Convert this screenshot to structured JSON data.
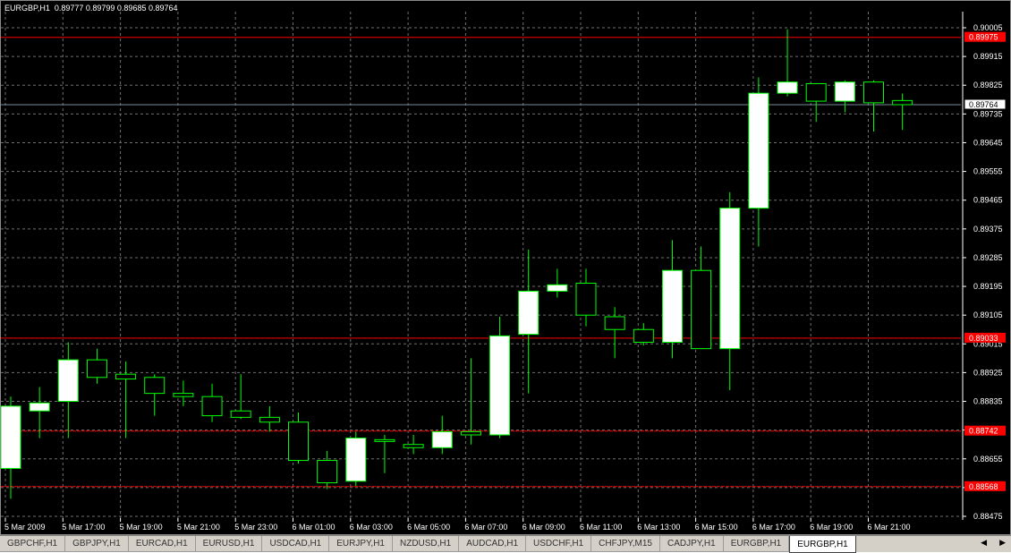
{
  "header": {
    "info": "EURGBP,H1  0.89777 0.89799 0.89685 0.89764"
  },
  "price_axis": {
    "ticks": [
      "0.90005",
      "0.89915",
      "0.89825",
      "0.89735",
      "0.89645",
      "0.89555",
      "0.89465",
      "0.89375",
      "0.89285",
      "0.89195",
      "0.89105",
      "0.89015",
      "0.88925",
      "0.88835",
      "0.88745",
      "0.88655",
      "0.88565",
      "0.88475"
    ]
  },
  "time_axis": {
    "labels": [
      "5 Mar 2009",
      "5 Mar 17:00",
      "5 Mar 19:00",
      "5 Mar 21:00",
      "5 Mar 23:00",
      "6 Mar 01:00",
      "6 Mar 03:00",
      "6 Mar 05:00",
      "6 Mar 07:00",
      "6 Mar 09:00",
      "6 Mar 11:00",
      "6 Mar 13:00",
      "6 Mar 15:00",
      "6 Mar 17:00",
      "6 Mar 19:00",
      "6 Mar 21:00"
    ]
  },
  "levels": [
    {
      "price": 0.89975,
      "label": "0.89975",
      "color": "#ff0000",
      "style": "solid"
    },
    {
      "price": 0.89033,
      "label": "0.89033",
      "color": "#ff0000",
      "style": "solid"
    },
    {
      "price": 0.88742,
      "label": "0.88742",
      "color": "#ff0000",
      "style": "dashed"
    },
    {
      "price": 0.88568,
      "label": "0.88568",
      "color": "#ff0000",
      "style": "dashed"
    }
  ],
  "bid_line": {
    "price": 0.89764,
    "label": "0.89764",
    "color": "#778899"
  },
  "candles": [
    {
      "o": 0.88625,
      "h": 0.8885,
      "l": 0.8853,
      "c": 0.8882
    },
    {
      "o": 0.88805,
      "h": 0.8888,
      "l": 0.8872,
      "c": 0.8883
    },
    {
      "o": 0.88835,
      "h": 0.8902,
      "l": 0.8872,
      "c": 0.88965
    },
    {
      "o": 0.88965,
      "h": 0.89,
      "l": 0.8889,
      "c": 0.8891
    },
    {
      "o": 0.8892,
      "h": 0.8896,
      "l": 0.8872,
      "c": 0.88905
    },
    {
      "o": 0.8891,
      "h": 0.8892,
      "l": 0.8879,
      "c": 0.8886
    },
    {
      "o": 0.8886,
      "h": 0.889,
      "l": 0.8882,
      "c": 0.8885
    },
    {
      "o": 0.8885,
      "h": 0.8889,
      "l": 0.8877,
      "c": 0.8879
    },
    {
      "o": 0.88805,
      "h": 0.8892,
      "l": 0.8878,
      "c": 0.88785
    },
    {
      "o": 0.88785,
      "h": 0.8882,
      "l": 0.8874,
      "c": 0.8877
    },
    {
      "o": 0.8877,
      "h": 0.888,
      "l": 0.8864,
      "c": 0.8865
    },
    {
      "o": 0.8865,
      "h": 0.8868,
      "l": 0.8856,
      "c": 0.8858
    },
    {
      "o": 0.88585,
      "h": 0.8874,
      "l": 0.8857,
      "c": 0.8872
    },
    {
      "o": 0.88715,
      "h": 0.8873,
      "l": 0.8861,
      "c": 0.8871
    },
    {
      "o": 0.887,
      "h": 0.8873,
      "l": 0.8867,
      "c": 0.8869
    },
    {
      "o": 0.8869,
      "h": 0.8879,
      "l": 0.8867,
      "c": 0.8874
    },
    {
      "o": 0.8874,
      "h": 0.8897,
      "l": 0.887,
      "c": 0.8873
    },
    {
      "o": 0.8873,
      "h": 0.891,
      "l": 0.8872,
      "c": 0.8904
    },
    {
      "o": 0.89045,
      "h": 0.8931,
      "l": 0.8886,
      "c": 0.8918
    },
    {
      "o": 0.8918,
      "h": 0.8925,
      "l": 0.8916,
      "c": 0.892
    },
    {
      "o": 0.89205,
      "h": 0.8925,
      "l": 0.8907,
      "c": 0.89105
    },
    {
      "o": 0.891,
      "h": 0.8913,
      "l": 0.8897,
      "c": 0.8906
    },
    {
      "o": 0.8906,
      "h": 0.8908,
      "l": 0.8901,
      "c": 0.8902
    },
    {
      "o": 0.8902,
      "h": 0.8934,
      "l": 0.8897,
      "c": 0.89245
    },
    {
      "o": 0.89245,
      "h": 0.8932,
      "l": 0.89,
      "c": 0.89
    },
    {
      "o": 0.89,
      "h": 0.8949,
      "l": 0.8887,
      "c": 0.8944
    },
    {
      "o": 0.8944,
      "h": 0.8985,
      "l": 0.8932,
      "c": 0.898
    },
    {
      "o": 0.898,
      "h": 0.9,
      "l": 0.8979,
      "c": 0.89835
    },
    {
      "o": 0.8983,
      "h": 0.8983,
      "l": 0.8971,
      "c": 0.89775
    },
    {
      "o": 0.89775,
      "h": 0.8984,
      "l": 0.8974,
      "c": 0.89835
    },
    {
      "o": 0.89835,
      "h": 0.8984,
      "l": 0.8968,
      "c": 0.8977
    },
    {
      "o": 0.89777,
      "h": 0.89799,
      "l": 0.89685,
      "c": 0.89764
    }
  ],
  "tabs": [
    {
      "label": "GBPCHF,H1",
      "active": false
    },
    {
      "label": "GBPJPY,H1",
      "active": false
    },
    {
      "label": "EURCAD,H1",
      "active": false
    },
    {
      "label": "EURUSD,H1",
      "active": false
    },
    {
      "label": "USDCAD,H1",
      "active": false
    },
    {
      "label": "EURJPY,H1",
      "active": false
    },
    {
      "label": "NZDUSD,H1",
      "active": false
    },
    {
      "label": "AUDCAD,H1",
      "active": false
    },
    {
      "label": "USDCHF,H1",
      "active": false
    },
    {
      "label": "CHFJPY,M15",
      "active": false
    },
    {
      "label": "CADJPY,H1",
      "active": false
    },
    {
      "label": "EURGBP,H1",
      "active": false
    },
    {
      "label": "EURGBP,H1",
      "active": true
    }
  ],
  "colors": {
    "bull_body": "#ffffff",
    "bear_body": "#000000",
    "wick": "#00ff00",
    "grid": "#707070",
    "background": "#000000"
  }
}
